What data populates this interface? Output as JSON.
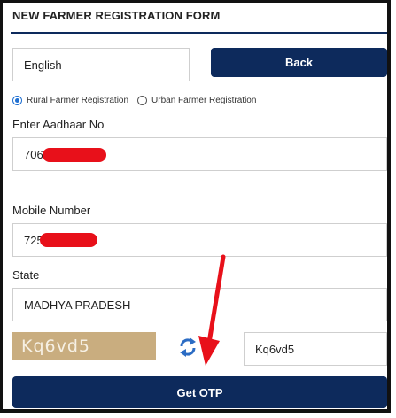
{
  "form": {
    "title": "NEW FARMER REGISTRATION FORM",
    "language_value": "English",
    "back_label": "Back",
    "radio_options": [
      {
        "label": "Rural Farmer Registration",
        "selected": true
      },
      {
        "label": "Urban Farmer Registration",
        "selected": false
      }
    ],
    "aadhaar_label": "Enter Aadhaar No",
    "aadhaar_value_visible": "706",
    "mobile_label": "Mobile Number",
    "mobile_value_visible": "725",
    "state_label": "State",
    "state_value": "MADHYA PRADESH",
    "captcha_text": "Kq6vd5",
    "captcha_input_value": "Kq6vd5",
    "get_otp_label": "Get OTP"
  },
  "colors": {
    "primary": "#0d2a5c",
    "redaction": "#e8101a",
    "annotation_arrow": "#e8101a",
    "refresh_icon": "#2b6cc4"
  },
  "icons": {
    "refresh": "refresh-icon",
    "annotation": "arrow-down-icon"
  }
}
